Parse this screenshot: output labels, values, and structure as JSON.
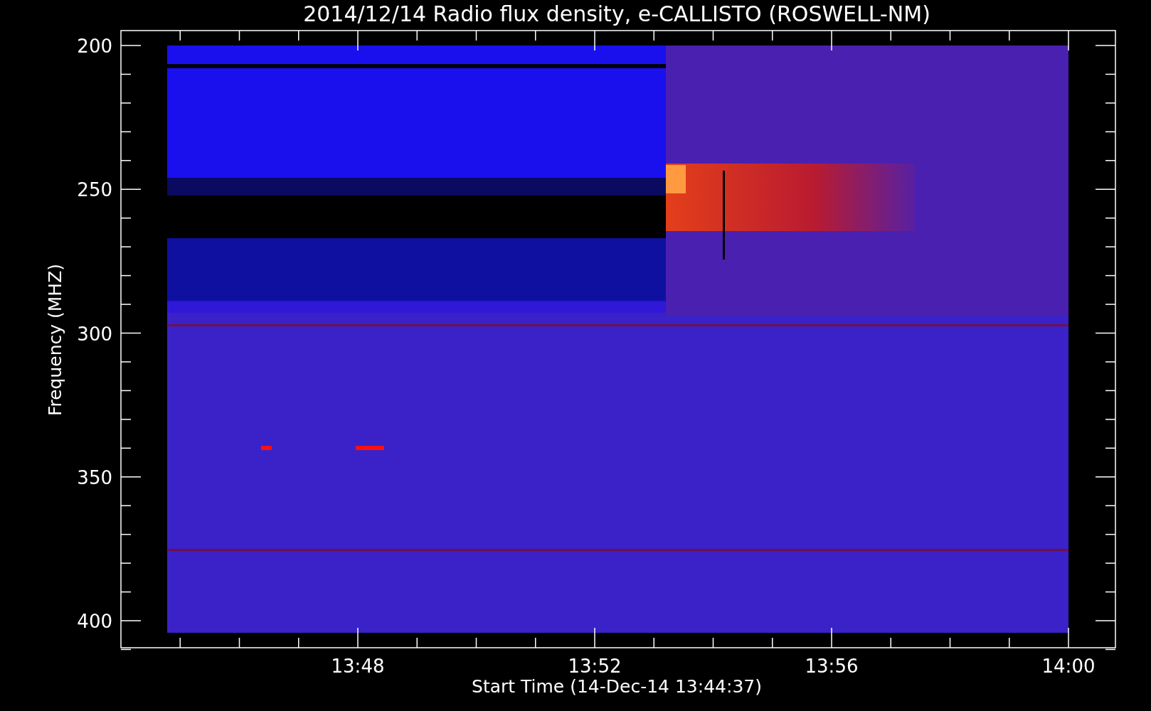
{
  "title": "2014/12/14  Radio flux density, e-CALLISTO (ROSWELL-NM)",
  "y_axis": {
    "label": "Frequency (MHZ)",
    "ticks": [
      "200",
      "250",
      "300",
      "350",
      "400"
    ]
  },
  "x_axis": {
    "label": "Start Time (14-Dec-14 13:44:37)",
    "ticks": [
      "13:48",
      "13:52",
      "13:56",
      "14:00"
    ]
  }
}
